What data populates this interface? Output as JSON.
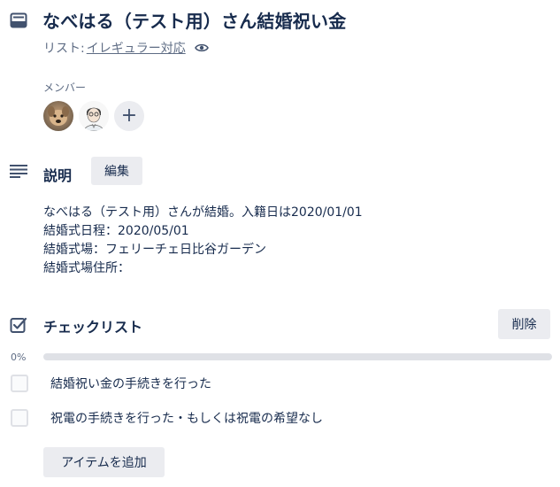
{
  "card": {
    "title": "なべはる（テスト用）さん結婚祝い金",
    "list_prefix": "リスト: ",
    "list_name": "イレギュラー対応"
  },
  "members": {
    "label": "メンバー",
    "add_label": "+"
  },
  "description": {
    "title": "説明",
    "edit_label": "編集",
    "lines": [
      "なべはる（テスト用）さんが結婚。入籍日は2020/01/01",
      "結婚式日程：2020/05/01",
      "結婚式場：フェリーチェ日比谷ガーデン",
      "結婚式場住所："
    ]
  },
  "checklist": {
    "title": "チェックリスト",
    "delete_label": "削除",
    "progress_label": "0%",
    "progress_value": 0,
    "items": [
      {
        "text": "結婚祝い金の手続きを行った",
        "checked": false
      },
      {
        "text": "祝電の手続きを行った・もしくは祝電の希望なし",
        "checked": false
      }
    ],
    "add_item_label": "アイテムを追加"
  },
  "icons": {
    "card": "card-icon",
    "watch": "eye-icon",
    "description": "description-icon",
    "checklist": "checklist-icon"
  },
  "colors": {
    "text": "#172b4d",
    "muted": "#5e6c84",
    "button_bg": "#ebecf0",
    "progress_track": "#dfe1e6"
  }
}
